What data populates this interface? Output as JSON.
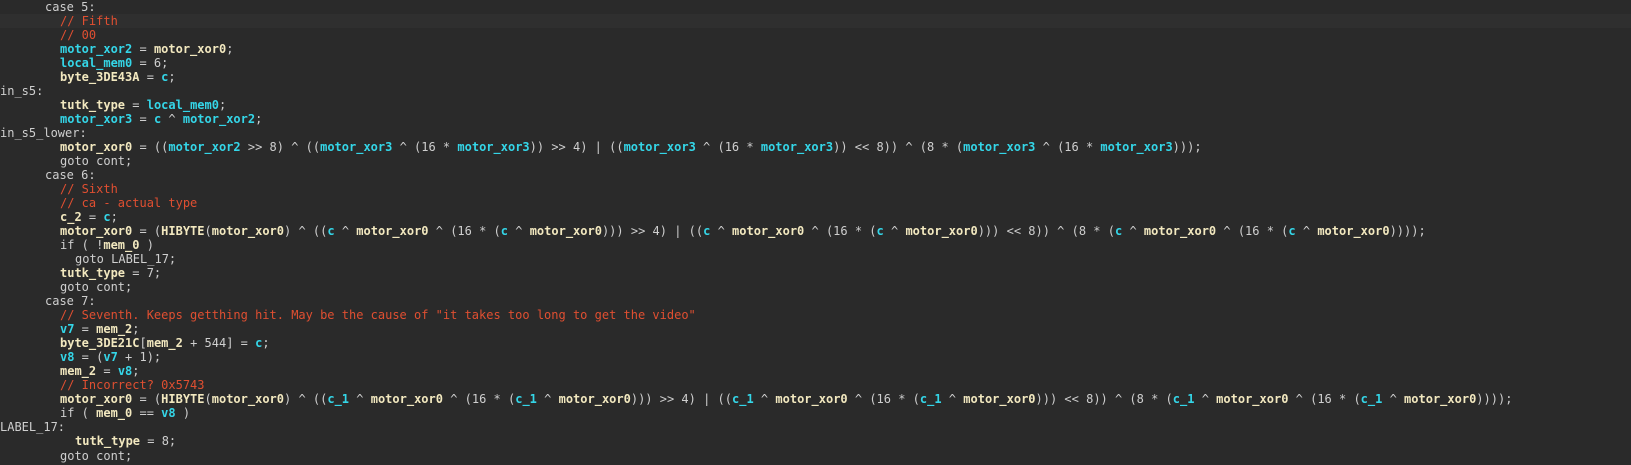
{
  "editor": {
    "lines": [
      {
        "indent": 3,
        "current": false,
        "segs": [
          {
            "t": "case 5:",
            "k": "g"
          }
        ]
      },
      {
        "indent": 4,
        "current": true,
        "segs": [
          {
            "t": "// Fifth",
            "k": "m"
          }
        ]
      },
      {
        "indent": 4,
        "segs": [
          {
            "t": "// 00",
            "k": "m"
          }
        ]
      },
      {
        "indent": 4,
        "segs": [
          {
            "t": "motor_xor2",
            "k": "c"
          },
          {
            "t": " = ",
            "k": "g"
          },
          {
            "t": "motor_xor0",
            "k": "v"
          },
          {
            "t": ";",
            "k": "g"
          }
        ]
      },
      {
        "indent": 4,
        "segs": [
          {
            "t": "local_mem0",
            "k": "c"
          },
          {
            "t": " = 6;",
            "k": "g"
          }
        ]
      },
      {
        "indent": 4,
        "segs": [
          {
            "t": "byte_3DE43A",
            "k": "v"
          },
          {
            "t": " = ",
            "k": "g"
          },
          {
            "t": "c",
            "k": "c"
          },
          {
            "t": ";",
            "k": "g"
          }
        ]
      },
      {
        "indent": 0,
        "segs": [
          {
            "t": "in_s5:",
            "k": "g"
          }
        ]
      },
      {
        "indent": 4,
        "segs": [
          {
            "t": "tutk_type",
            "k": "v"
          },
          {
            "t": " = ",
            "k": "g"
          },
          {
            "t": "local_mem0",
            "k": "c"
          },
          {
            "t": ";",
            "k": "g"
          }
        ]
      },
      {
        "indent": 4,
        "segs": [
          {
            "t": "motor_xor3",
            "k": "c"
          },
          {
            "t": " = ",
            "k": "g"
          },
          {
            "t": "c",
            "k": "c"
          },
          {
            "t": " ^ ",
            "k": "g"
          },
          {
            "t": "motor_xor2",
            "k": "c"
          },
          {
            "t": ";",
            "k": "g"
          }
        ]
      },
      {
        "indent": 0,
        "segs": [
          {
            "t": "in_s5_lower:",
            "k": "g"
          }
        ]
      },
      {
        "indent": 4,
        "segs": [
          {
            "t": "motor_xor0",
            "k": "v"
          },
          {
            "t": " = ((",
            "k": "g"
          },
          {
            "t": "motor_xor2",
            "k": "c"
          },
          {
            "t": " >> 8) ^ ((",
            "k": "g"
          },
          {
            "t": "motor_xor3",
            "k": "c"
          },
          {
            "t": " ^ (16 * ",
            "k": "g"
          },
          {
            "t": "motor_xor3",
            "k": "c"
          },
          {
            "t": ")) >> 4) | ((",
            "k": "g"
          },
          {
            "t": "motor_xor3",
            "k": "c"
          },
          {
            "t": " ^ (16 * ",
            "k": "g"
          },
          {
            "t": "motor_xor3",
            "k": "c"
          },
          {
            "t": ")) << 8)) ^ (8 * (",
            "k": "g"
          },
          {
            "t": "motor_xor3",
            "k": "c"
          },
          {
            "t": " ^ (16 * ",
            "k": "g"
          },
          {
            "t": "motor_xor3",
            "k": "c"
          },
          {
            "t": ")));",
            "k": "g"
          }
        ]
      },
      {
        "indent": 4,
        "segs": [
          {
            "t": "goto cont;",
            "k": "g"
          }
        ]
      },
      {
        "indent": 3,
        "segs": [
          {
            "t": "case 6:",
            "k": "g"
          }
        ]
      },
      {
        "indent": 4,
        "segs": [
          {
            "t": "// Sixth",
            "k": "m"
          }
        ]
      },
      {
        "indent": 4,
        "segs": [
          {
            "t": "// ca - actual type",
            "k": "m"
          }
        ]
      },
      {
        "indent": 4,
        "segs": [
          {
            "t": "c_2",
            "k": "v"
          },
          {
            "t": " = ",
            "k": "g"
          },
          {
            "t": "c",
            "k": "c"
          },
          {
            "t": ";",
            "k": "g"
          }
        ]
      },
      {
        "indent": 4,
        "segs": [
          {
            "t": "motor_xor0",
            "k": "v"
          },
          {
            "t": " = (",
            "k": "g"
          },
          {
            "t": "HIBYTE",
            "k": "v"
          },
          {
            "t": "(",
            "k": "g"
          },
          {
            "t": "motor_xor0",
            "k": "v"
          },
          {
            "t": ") ^ ((",
            "k": "g"
          },
          {
            "t": "c",
            "k": "c"
          },
          {
            "t": " ^ ",
            "k": "g"
          },
          {
            "t": "motor_xor0",
            "k": "v"
          },
          {
            "t": " ^ (16 * (",
            "k": "g"
          },
          {
            "t": "c",
            "k": "c"
          },
          {
            "t": " ^ ",
            "k": "g"
          },
          {
            "t": "motor_xor0",
            "k": "v"
          },
          {
            "t": "))) >> 4) | ((",
            "k": "g"
          },
          {
            "t": "c",
            "k": "c"
          },
          {
            "t": " ^ ",
            "k": "g"
          },
          {
            "t": "motor_xor0",
            "k": "v"
          },
          {
            "t": " ^ (16 * (",
            "k": "g"
          },
          {
            "t": "c",
            "k": "c"
          },
          {
            "t": " ^ ",
            "k": "g"
          },
          {
            "t": "motor_xor0",
            "k": "v"
          },
          {
            "t": "))) << 8)) ^ (8 * (",
            "k": "g"
          },
          {
            "t": "c",
            "k": "c"
          },
          {
            "t": " ^ ",
            "k": "g"
          },
          {
            "t": "motor_xor0",
            "k": "v"
          },
          {
            "t": " ^ (16 * (",
            "k": "g"
          },
          {
            "t": "c",
            "k": "c"
          },
          {
            "t": " ^ ",
            "k": "g"
          },
          {
            "t": "motor_xor0",
            "k": "v"
          },
          {
            "t": "))));",
            "k": "g"
          }
        ]
      },
      {
        "indent": 4,
        "segs": [
          {
            "t": "if ( !",
            "k": "g"
          },
          {
            "t": "mem_0",
            "k": "v"
          },
          {
            "t": " )",
            "k": "g"
          }
        ]
      },
      {
        "indent": 5,
        "segs": [
          {
            "t": "goto LABEL_17;",
            "k": "g"
          }
        ]
      },
      {
        "indent": 4,
        "segs": [
          {
            "t": "tutk_type",
            "k": "v"
          },
          {
            "t": " = 7;",
            "k": "g"
          }
        ]
      },
      {
        "indent": 4,
        "segs": [
          {
            "t": "goto cont;",
            "k": "g"
          }
        ]
      },
      {
        "indent": 3,
        "segs": [
          {
            "t": "case 7:",
            "k": "g"
          }
        ]
      },
      {
        "indent": 4,
        "segs": [
          {
            "t": "// Seventh. Keeps getthing hit. May be the cause of \"it takes too long to get the video\"",
            "k": "m"
          }
        ]
      },
      {
        "indent": 4,
        "segs": [
          {
            "t": "v7",
            "k": "c"
          },
          {
            "t": " = ",
            "k": "g"
          },
          {
            "t": "mem_2",
            "k": "v"
          },
          {
            "t": ";",
            "k": "g"
          }
        ]
      },
      {
        "indent": 4,
        "segs": [
          {
            "t": "byte_3DE21C",
            "k": "v"
          },
          {
            "t": "[",
            "k": "g"
          },
          {
            "t": "mem_2",
            "k": "v"
          },
          {
            "t": " + 544] = ",
            "k": "g"
          },
          {
            "t": "c",
            "k": "c"
          },
          {
            "t": ";",
            "k": "g"
          }
        ]
      },
      {
        "indent": 4,
        "segs": [
          {
            "t": "v8",
            "k": "c"
          },
          {
            "t": " = (",
            "k": "g"
          },
          {
            "t": "v7",
            "k": "c"
          },
          {
            "t": " + 1);",
            "k": "g"
          }
        ]
      },
      {
        "indent": 4,
        "segs": [
          {
            "t": "mem_2",
            "k": "v"
          },
          {
            "t": " = ",
            "k": "g"
          },
          {
            "t": "v8",
            "k": "c"
          },
          {
            "t": ";",
            "k": "g"
          }
        ]
      },
      {
        "indent": 4,
        "segs": [
          {
            "t": "// Incorrect? 0x5743",
            "k": "m"
          }
        ]
      },
      {
        "indent": 4,
        "segs": [
          {
            "t": "motor_xor0",
            "k": "v"
          },
          {
            "t": " = (",
            "k": "g"
          },
          {
            "t": "HIBYTE",
            "k": "v"
          },
          {
            "t": "(",
            "k": "g"
          },
          {
            "t": "motor_xor0",
            "k": "v"
          },
          {
            "t": ") ^ ((",
            "k": "g"
          },
          {
            "t": "c_1",
            "k": "c"
          },
          {
            "t": " ^ ",
            "k": "g"
          },
          {
            "t": "motor_xor0",
            "k": "v"
          },
          {
            "t": " ^ (16 * (",
            "k": "g"
          },
          {
            "t": "c_1",
            "k": "c"
          },
          {
            "t": " ^ ",
            "k": "g"
          },
          {
            "t": "motor_xor0",
            "k": "v"
          },
          {
            "t": "))) >> 4) | ((",
            "k": "g"
          },
          {
            "t": "c_1",
            "k": "c"
          },
          {
            "t": " ^ ",
            "k": "g"
          },
          {
            "t": "motor_xor0",
            "k": "v"
          },
          {
            "t": " ^ (16 * (",
            "k": "g"
          },
          {
            "t": "c_1",
            "k": "c"
          },
          {
            "t": " ^ ",
            "k": "g"
          },
          {
            "t": "motor_xor0",
            "k": "v"
          },
          {
            "t": "))) << 8)) ^ (8 * (",
            "k": "g"
          },
          {
            "t": "c_1",
            "k": "c"
          },
          {
            "t": " ^ ",
            "k": "g"
          },
          {
            "t": "motor_xor0",
            "k": "v"
          },
          {
            "t": " ^ (16 * (",
            "k": "g"
          },
          {
            "t": "c_1",
            "k": "c"
          },
          {
            "t": " ^ ",
            "k": "g"
          },
          {
            "t": "motor_xor0",
            "k": "v"
          },
          {
            "t": "))));",
            "k": "g"
          }
        ]
      },
      {
        "indent": 4,
        "segs": [
          {
            "t": "if ( ",
            "k": "g"
          },
          {
            "t": "mem_0",
            "k": "v"
          },
          {
            "t": " == ",
            "k": "g"
          },
          {
            "t": "v8",
            "k": "c"
          },
          {
            "t": " )",
            "k": "g"
          }
        ]
      },
      {
        "indent": 0,
        "segs": [
          {
            "t": "LABEL_17:",
            "k": "g"
          }
        ]
      },
      {
        "indent": 5,
        "segs": [
          {
            "t": "tutk_type",
            "k": "v"
          },
          {
            "t": " = 8;",
            "k": "g"
          }
        ]
      },
      {
        "indent": 4,
        "segs": [
          {
            "t": "goto cont;",
            "k": "g"
          }
        ]
      }
    ]
  },
  "colors": {
    "background": "#2a2a2a",
    "plain": "#cfcfcf",
    "variable": "#f2e8bf",
    "cyan": "#34d6e8",
    "comment": "#e04f31"
  }
}
